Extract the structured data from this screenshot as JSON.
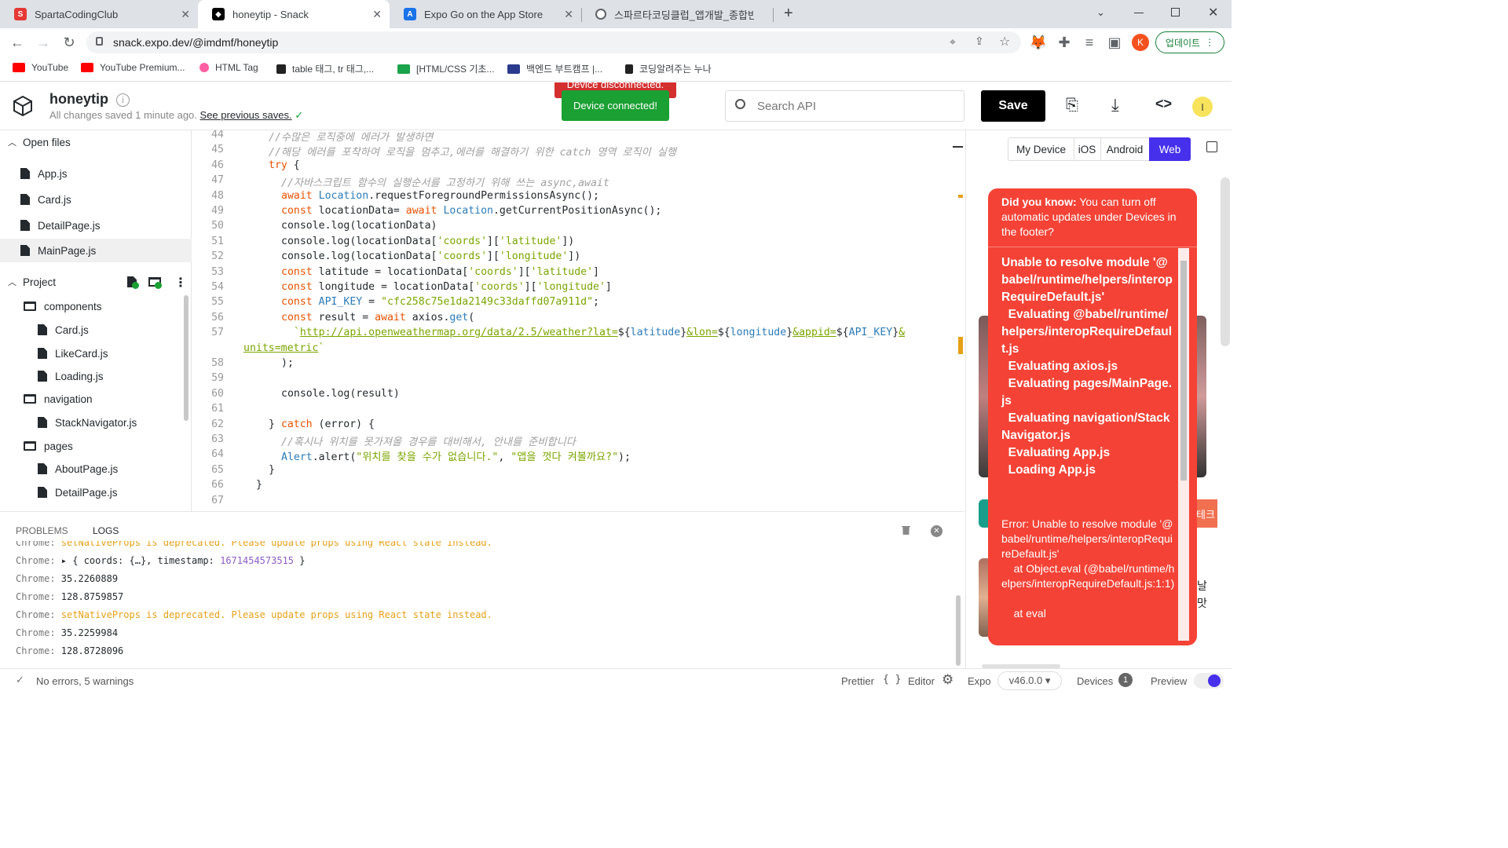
{
  "browser": {
    "tabs": [
      {
        "title": "SpartaCodingClub",
        "icon": "sparta-icon"
      },
      {
        "title": "honeytip - Snack",
        "icon": "snack-icon"
      },
      {
        "title": "Expo Go on the App Store",
        "icon": "appstore-icon"
      },
      {
        "title": "스파르타코딩클럽_앱개발_종합반",
        "icon": "globe-icon"
      }
    ],
    "url": "snack.expo.dev/@imdmf/honeytip",
    "profile_initial": "K",
    "update_button": "업데이트",
    "bookmarks": [
      {
        "label": "YouTube",
        "color": "#ff0000"
      },
      {
        "label": "YouTube Premium...",
        "color": "#ff0000"
      },
      {
        "label": "HTML Tag",
        "color": "#ff5fa2"
      },
      {
        "label": "table 태그, tr 태그,...",
        "color": "#222222"
      },
      {
        "label": "[HTML/CSS 기초...",
        "color": "#1aa34a"
      },
      {
        "label": "백엔드 부트캠프 |...",
        "color": "#2a3a8c"
      },
      {
        "label": "코딩알려주는 누나",
        "color": "#222222"
      }
    ]
  },
  "snack": {
    "project_name": "honeytip",
    "save_status": "All changes saved 1 minute ago.",
    "see_previous": "See previous saves.",
    "toast_disconnected": "Device disconnected.",
    "toast_connected": "Device connected!",
    "search_placeholder": "Search API",
    "save_label": "Save",
    "avatar_initial": "I"
  },
  "sidebar": {
    "open_files_title": "Open files",
    "open_files": [
      "App.js",
      "Card.js",
      "DetailPage.js",
      "MainPage.js"
    ],
    "project_title": "Project",
    "tree": [
      {
        "label": "components",
        "type": "folder",
        "depth": 0
      },
      {
        "label": "Card.js",
        "type": "file",
        "depth": 1
      },
      {
        "label": "LikeCard.js",
        "type": "file",
        "depth": 1
      },
      {
        "label": "Loading.js",
        "type": "file",
        "depth": 1
      },
      {
        "label": "navigation",
        "type": "folder",
        "depth": 0
      },
      {
        "label": "StackNavigator.js",
        "type": "file",
        "depth": 1
      },
      {
        "label": "pages",
        "type": "folder",
        "depth": 0
      },
      {
        "label": "AboutPage.js",
        "type": "file",
        "depth": 1
      },
      {
        "label": "DetailPage.js",
        "type": "file",
        "depth": 1
      }
    ]
  },
  "editor": {
    "lines": [
      {
        "n": "44",
        "html": "<span class='cm'>//수많은 로직중에 에러가 발생하면</span>",
        "indent": 2
      },
      {
        "n": "45",
        "html": "<span class='cm'>//해당 에러를 포착하여 로직을 멈추고,에러를 해결하기 위한 catch 영역 로직이 실행</span>",
        "indent": 2
      },
      {
        "n": "46",
        "html": "<span class='kw'>try</span> {",
        "indent": 2
      },
      {
        "n": "47",
        "html": "<span class='cm'>//자바스크립트 함수의 실행순서를 고정하기 위해 쓰는 async,await</span>",
        "indent": 3
      },
      {
        "n": "48",
        "html": "<span class='kw'>await</span> <span class='fn'>Location</span>.requestForegroundPermissionsAsync();",
        "indent": 3
      },
      {
        "n": "49",
        "html": "<span class='kw'>const</span> locationData= <span class='kw'>await</span> <span class='fn'>Location</span>.getCurrentPositionAsync();",
        "indent": 3
      },
      {
        "n": "50",
        "html": "console.log(locationData)",
        "indent": 3
      },
      {
        "n": "51",
        "html": "console.log(locationData[<span class='str'>'coords'</span>][<span class='str'>'latitude'</span>])",
        "indent": 3
      },
      {
        "n": "52",
        "html": "console.log(locationData[<span class='str'>'coords'</span>][<span class='str'>'longitude'</span>])",
        "indent": 3
      },
      {
        "n": "53",
        "html": "<span class='kw'>const</span> latitude = locationData[<span class='str'>'coords'</span>][<span class='str'>'latitude'</span>]",
        "indent": 3
      },
      {
        "n": "54",
        "html": "<span class='kw'>const</span> longitude = locationData[<span class='str'>'coords'</span>][<span class='str'>'longitude'</span>]",
        "indent": 3
      },
      {
        "n": "55",
        "html": "<span class='kw'>const</span> <span class='fn'>API_KEY</span> = <span class='str'>\"cfc258c75e1da2149c33daffd07a911d\"</span>;",
        "indent": 3
      },
      {
        "n": "56",
        "html": "<span class='kw'>const</span> result = <span class='kw'>await</span> axios.<span class='fn'>get</span>(",
        "indent": 3
      },
      {
        "n": "57",
        "html": "  <span class='str'>`</span><span class='ustr'>http://api.openweathermap.org/data/2.5/weather?lat=</span>${<span class='tpl'>latitude</span>}<span class='ustr'>&amp;lon=</span>${<span class='tpl'>longitude</span>}<span class='ustr'>&amp;appid=</span>${<span class='fn'>API_KEY</span>}<span class='ustr'>&amp;</span>",
        "indent": 3
      },
      {
        "n": "",
        "html": "<span class='ustr'>units=metric</span><span class='str'>`</span>",
        "indent": 0
      },
      {
        "n": "58",
        "html": ");",
        "indent": 3
      },
      {
        "n": "59",
        "html": "",
        "indent": 3
      },
      {
        "n": "60",
        "html": "console.log(result)",
        "indent": 3
      },
      {
        "n": "61",
        "html": "",
        "indent": 3
      },
      {
        "n": "62",
        "html": "} <span class='kw'>catch</span> (error) {",
        "indent": 2
      },
      {
        "n": "63",
        "html": "<span class='cm'>//혹시나 위치를 못가져올 경우를 대비해서, 안내를 준비합니다</span>",
        "indent": 3
      },
      {
        "n": "64",
        "html": "<span class='fn'>Alert</span>.alert(<span class='str'>\"위치를 찾을 수가 없습니다.\"</span>, <span class='str'>\"앱을 껏다 켜볼까요?\"</span>);",
        "indent": 3
      },
      {
        "n": "65",
        "html": "}",
        "indent": 2
      },
      {
        "n": "66",
        "html": "}",
        "indent": 1
      },
      {
        "n": "67",
        "html": "",
        "indent": 0
      }
    ]
  },
  "console": {
    "tab_problems": "PROBLEMS",
    "tab_logs": "LOGS",
    "logs": [
      {
        "src": "Chrome:",
        "text": "setNativeProps is deprecated. Please update props using React state instead.",
        "kind": "warn"
      },
      {
        "src": "Chrome:",
        "text": "▸ { coords: {…}, timestamp: ",
        "num": "1671454573515",
        "tail": " }",
        "kind": "obj"
      },
      {
        "src": "Chrome:",
        "text": "35.2260889",
        "kind": "plain"
      },
      {
        "src": "Chrome:",
        "text": "128.8759857",
        "kind": "plain"
      },
      {
        "src": "Chrome:",
        "text": "setNativeProps is deprecated. Please update props using React state instead.",
        "kind": "warn"
      },
      {
        "src": "Chrome:",
        "text": "35.2259984",
        "kind": "plain"
      },
      {
        "src": "Chrome:",
        "text": "128.8728096",
        "kind": "plain"
      }
    ]
  },
  "statusbar": {
    "status": "No errors, 5 warnings",
    "prettier": "Prettier",
    "editor": "Editor",
    "expo": "Expo",
    "version": "v46.0.0 ▾",
    "devices": "Devices",
    "devices_count": "1",
    "preview": "Preview"
  },
  "preview": {
    "segments": [
      "My Device",
      "iOS",
      "Android",
      "Web"
    ],
    "active_segment": "Web",
    "tip_bold": "Did you know:",
    "tip_text": "You can turn off automatic updates under Devices in the footer?",
    "module_error": "Unable to resolve module '@babel/runtime/helpers/interopRequireDefault.js'\n  Evaluating @babel/runtime/helpers/interopRequireDefault.js\n  Evaluating axios.js\n  Evaluating pages/MainPage.js\n  Evaluating navigation/StackNavigator.js\n  Evaluating App.js\n  Loading App.js",
    "error_detail": "Error: Unable to resolve module '@babel/runtime/helpers/interopRequireDefault.js'\n    at Object.eval (@babel/runtime/helpers/interopRequireDefault.js:1:1)\n\n    at eval",
    "side_text_1": "테크",
    "side_text_2": "날",
    "side_text_3": "맛"
  },
  "colors": {
    "accent": "#4630eb",
    "error": "#f44336",
    "toast_green": "#1aa033",
    "toast_red": "#d32f2f",
    "save_bg": "#000000"
  }
}
